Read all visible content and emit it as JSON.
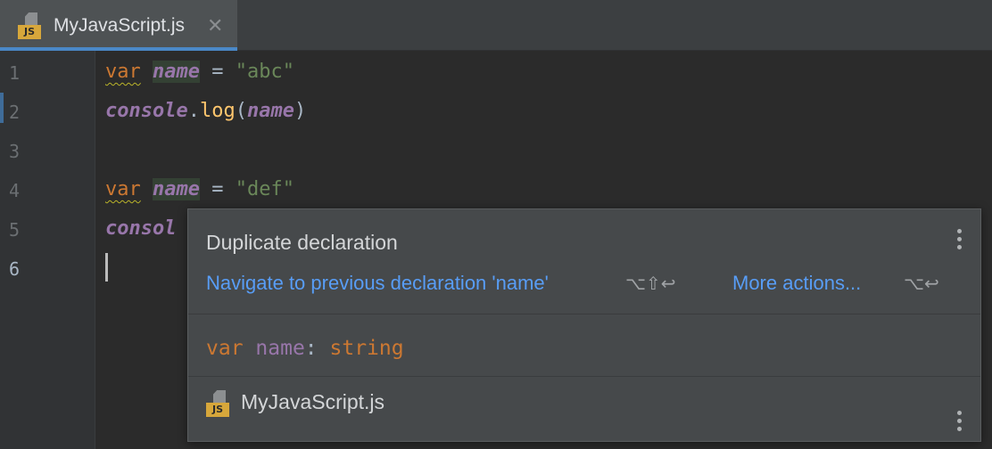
{
  "tab": {
    "icon": "js-file-icon",
    "badge": "JS",
    "label": "MyJavaScript.js",
    "close": "✕"
  },
  "gutter": {
    "line_numbers": [
      "1",
      "2",
      "3",
      "4",
      "5",
      "6"
    ]
  },
  "code": {
    "line1": {
      "kw": "var",
      "name": "name",
      "op": " = ",
      "str": "\"abc\""
    },
    "line2": {
      "obj": "console",
      "dot": ".",
      "method": "log",
      "open": "(",
      "arg": "name",
      "close": ")"
    },
    "line4": {
      "kw": "var",
      "name": "name",
      "op": " = ",
      "str": "\"def\""
    },
    "line5": {
      "partial": "consol"
    }
  },
  "popup": {
    "title": "Duplicate declaration",
    "navigate_action": "Navigate to previous declaration 'name'",
    "navigate_shortcut": "⌥⇧↩",
    "more_actions": "More actions...",
    "more_shortcut": "⌥↩",
    "signature": {
      "kw": "var",
      "name": "name",
      "colon": ": ",
      "type": "string"
    },
    "file_badge": "JS",
    "file_name": "MyJavaScript.js"
  },
  "colors": {
    "editor_bg": "#2b2b2b",
    "keyword": "#cc7832",
    "identifier": "#9876aa",
    "string": "#6a8759",
    "method": "#ffc66d",
    "link": "#589df6",
    "tab_underline": "#4a88c7"
  }
}
